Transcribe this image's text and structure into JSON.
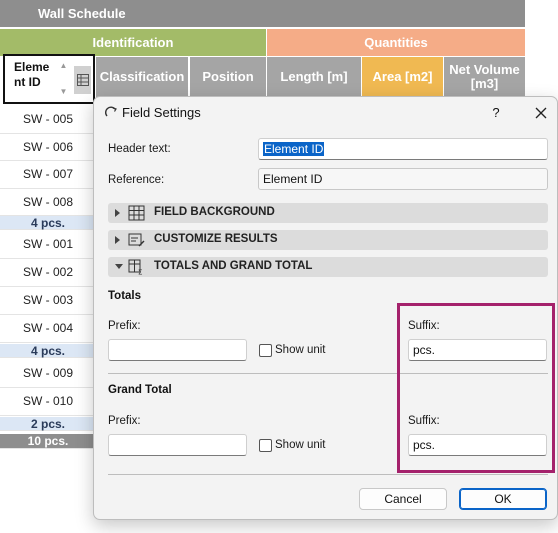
{
  "schedule": {
    "title": "Wall Schedule",
    "group_identification": "Identification",
    "group_quantities": "Quantities",
    "col_element_id": "Eleme nt ID",
    "col_classification": "Classification",
    "col_position": "Position",
    "col_length": "Length [m]",
    "col_area": "Area [m2]",
    "col_net_volume": "Net Volume [m3]",
    "rows": [
      {
        "label": "SW - 005"
      },
      {
        "label": "SW - 006"
      },
      {
        "label": "SW - 007"
      },
      {
        "label": "SW - 008"
      },
      {
        "label": "4 pcs."
      },
      {
        "label": "SW - 001"
      },
      {
        "label": "SW - 002"
      },
      {
        "label": "SW - 003"
      },
      {
        "label": "SW - 004"
      },
      {
        "label": "4 pcs."
      },
      {
        "label": "SW - 009"
      },
      {
        "label": "SW - 010"
      },
      {
        "label": "2 pcs."
      },
      {
        "label": "10 pcs."
      }
    ]
  },
  "dialog": {
    "title": "Field Settings",
    "help": "?",
    "header_text_label": "Header text:",
    "header_text_value": "Element ID",
    "reference_label": "Reference:",
    "reference_value": "Element ID",
    "sections": {
      "field_background": "FIELD BACKGROUND",
      "customize_results": "CUSTOMIZE RESULTS",
      "totals_grand_total": "TOTALS AND GRAND TOTAL"
    },
    "totals": {
      "heading": "Totals",
      "prefix_label": "Prefix:",
      "prefix_value": "",
      "show_unit_label": "Show unit",
      "show_unit_checked": false,
      "suffix_label": "Suffix:",
      "suffix_value": "pcs."
    },
    "grand_total": {
      "heading": "Grand Total",
      "prefix_label": "Prefix:",
      "prefix_value": "",
      "show_unit_label": "Show unit",
      "show_unit_checked": false,
      "suffix_label": "Suffix:",
      "suffix_value": "pcs."
    },
    "cancel_label": "Cancel",
    "ok_label": "OK"
  },
  "colors": {
    "identification": "#a3bb68",
    "quantities": "#f5ac87",
    "area_header": "#f0b952",
    "callout": "#a4216b",
    "accent": "#0a64c8"
  }
}
